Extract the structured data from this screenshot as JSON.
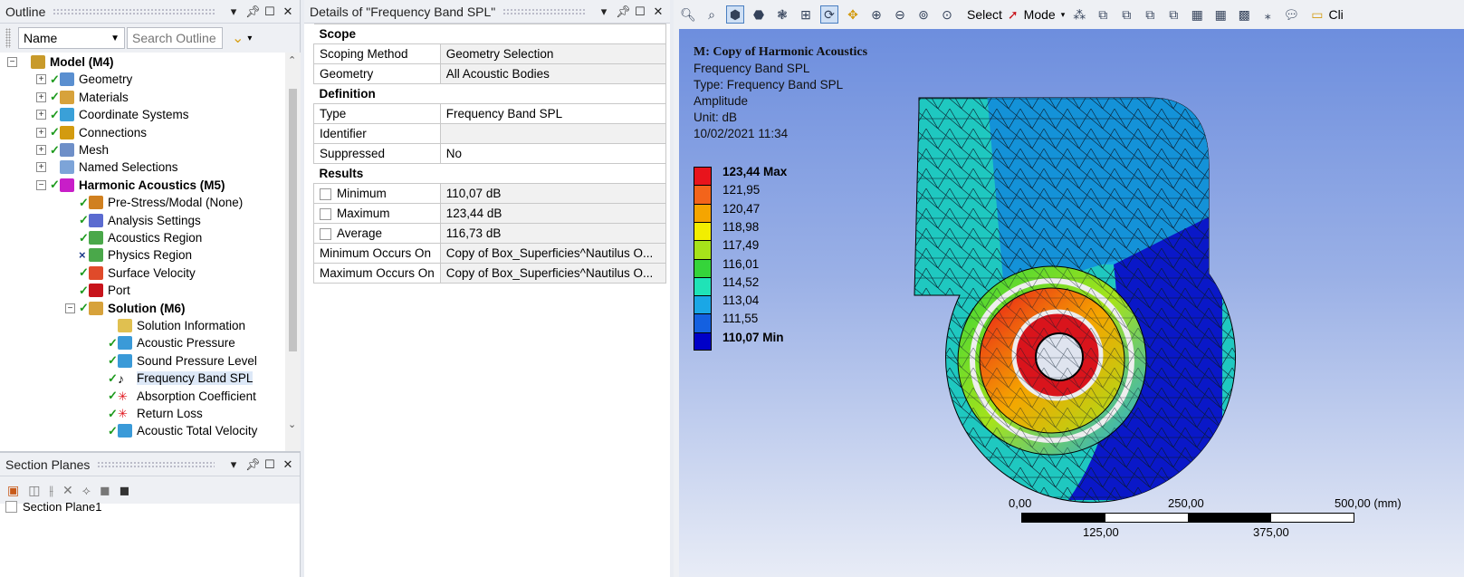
{
  "outline": {
    "title": "Outline",
    "filter_label": "Name",
    "search_placeholder": "Search Outline",
    "tree": [
      {
        "label": "Model (M4)",
        "bold": true,
        "icon": "model-icon",
        "check": false,
        "exp": "−"
      },
      {
        "label": "Geometry",
        "icon": "geometry-icon",
        "check": true,
        "exp": "+"
      },
      {
        "label": "Materials",
        "icon": "materials-icon",
        "check": true,
        "exp": "+"
      },
      {
        "label": "Coordinate Systems",
        "icon": "coordinate-icon",
        "check": true,
        "exp": "+"
      },
      {
        "label": "Connections",
        "icon": "connections-icon",
        "check": true,
        "exp": "+"
      },
      {
        "label": "Mesh",
        "icon": "mesh-icon",
        "check": true,
        "exp": "+"
      },
      {
        "label": "Named Selections",
        "icon": "named-selection-icon",
        "check": false,
        "exp": "+"
      },
      {
        "label": "Harmonic Acoustics (M5)",
        "bold": true,
        "icon": "harmonic-icon",
        "check": true,
        "exp": "−"
      },
      {
        "label": "Pre-Stress/Modal (None)",
        "icon": "prestress-icon",
        "check": true
      },
      {
        "label": "Analysis Settings",
        "icon": "settings-icon",
        "check": true
      },
      {
        "label": "Acoustics Region",
        "icon": "region-icon",
        "check": true
      },
      {
        "label": "Physics Region",
        "icon": "region-icon",
        "check": false,
        "cross": true
      },
      {
        "label": "Surface Velocity",
        "icon": "velocity-icon",
        "check": true
      },
      {
        "label": "Port",
        "icon": "port-icon",
        "check": true
      },
      {
        "label": "Solution (M6)",
        "bold": true,
        "icon": "solution-icon",
        "check": true,
        "exp": "−"
      },
      {
        "label": "Solution Information",
        "icon": "info-icon",
        "check": false
      },
      {
        "label": "Acoustic Pressure",
        "icon": "result-icon",
        "check": true
      },
      {
        "label": "Sound Pressure Level",
        "icon": "result-icon",
        "check": true
      },
      {
        "label": "Frequency Band SPL",
        "icon": "note-icon",
        "check": true,
        "selected": true
      },
      {
        "label": "Absorption Coefficient",
        "icon": "star-icon",
        "check": true
      },
      {
        "label": "Return Loss",
        "icon": "star-icon",
        "check": true
      },
      {
        "label": "Acoustic Total Velocity",
        "icon": "result-icon",
        "check": true
      }
    ]
  },
  "section": {
    "title": "Section Planes",
    "plane_label": "Section Plane1"
  },
  "details": {
    "title": "Details of \"Frequency Band SPL\"",
    "groups": [
      {
        "name": "Scope",
        "rows": [
          {
            "k": "Scoping Method",
            "v": "Geometry Selection"
          },
          {
            "k": "Geometry",
            "v": "All Acoustic Bodies"
          }
        ]
      },
      {
        "name": "Definition",
        "rows": [
          {
            "k": "Type",
            "v": "Frequency Band SPL",
            "white": true
          },
          {
            "k": "Identifier",
            "v": ""
          },
          {
            "k": "Suppressed",
            "v": "No",
            "white": true
          }
        ]
      },
      {
        "name": "Results",
        "rows": [
          {
            "k": "Minimum",
            "v": "110,07 dB",
            "cb": true
          },
          {
            "k": "Maximum",
            "v": "123,44 dB",
            "cb": true
          },
          {
            "k": "Average",
            "v": "116,73 dB",
            "cb": true
          },
          {
            "k": "Minimum Occurs On",
            "v": "Copy of Box_Superficies^Nautilus O..."
          },
          {
            "k": "Maximum Occurs On",
            "v": "Copy of Box_Superficies^Nautilus O..."
          }
        ]
      }
    ]
  },
  "viewer": {
    "select_label": "Select",
    "mode_label": "Mode",
    "clip_label": "Cli",
    "ann": {
      "title": "M: Copy of Harmonic Acoustics",
      "l1": "Frequency Band SPL",
      "l2": "Type: Frequency Band SPL",
      "l3": "Amplitude",
      "l4": "Unit: dB",
      "l5": "10/02/2021 11:34"
    },
    "legend": [
      {
        "v": "123,44 Max",
        "c": "#e8141c",
        "bold": true
      },
      {
        "v": "121,95",
        "c": "#f3641b"
      },
      {
        "v": "120,47",
        "c": "#f5a500"
      },
      {
        "v": "118,98",
        "c": "#f2ee00"
      },
      {
        "v": "117,49",
        "c": "#a6e31a"
      },
      {
        "v": "116,01",
        "c": "#35d43a"
      },
      {
        "v": "114,52",
        "c": "#1fe3b7"
      },
      {
        "v": "113,04",
        "c": "#1aa7e6"
      },
      {
        "v": "111,55",
        "c": "#1460e0"
      },
      {
        "v": "110,07 Min",
        "c": "#0000c8",
        "bold": true
      }
    ],
    "scale": {
      "t0": "0,00",
      "t1": "250,00",
      "t2": "500,00 (mm)",
      "b1": "125,00",
      "b2": "375,00"
    }
  }
}
